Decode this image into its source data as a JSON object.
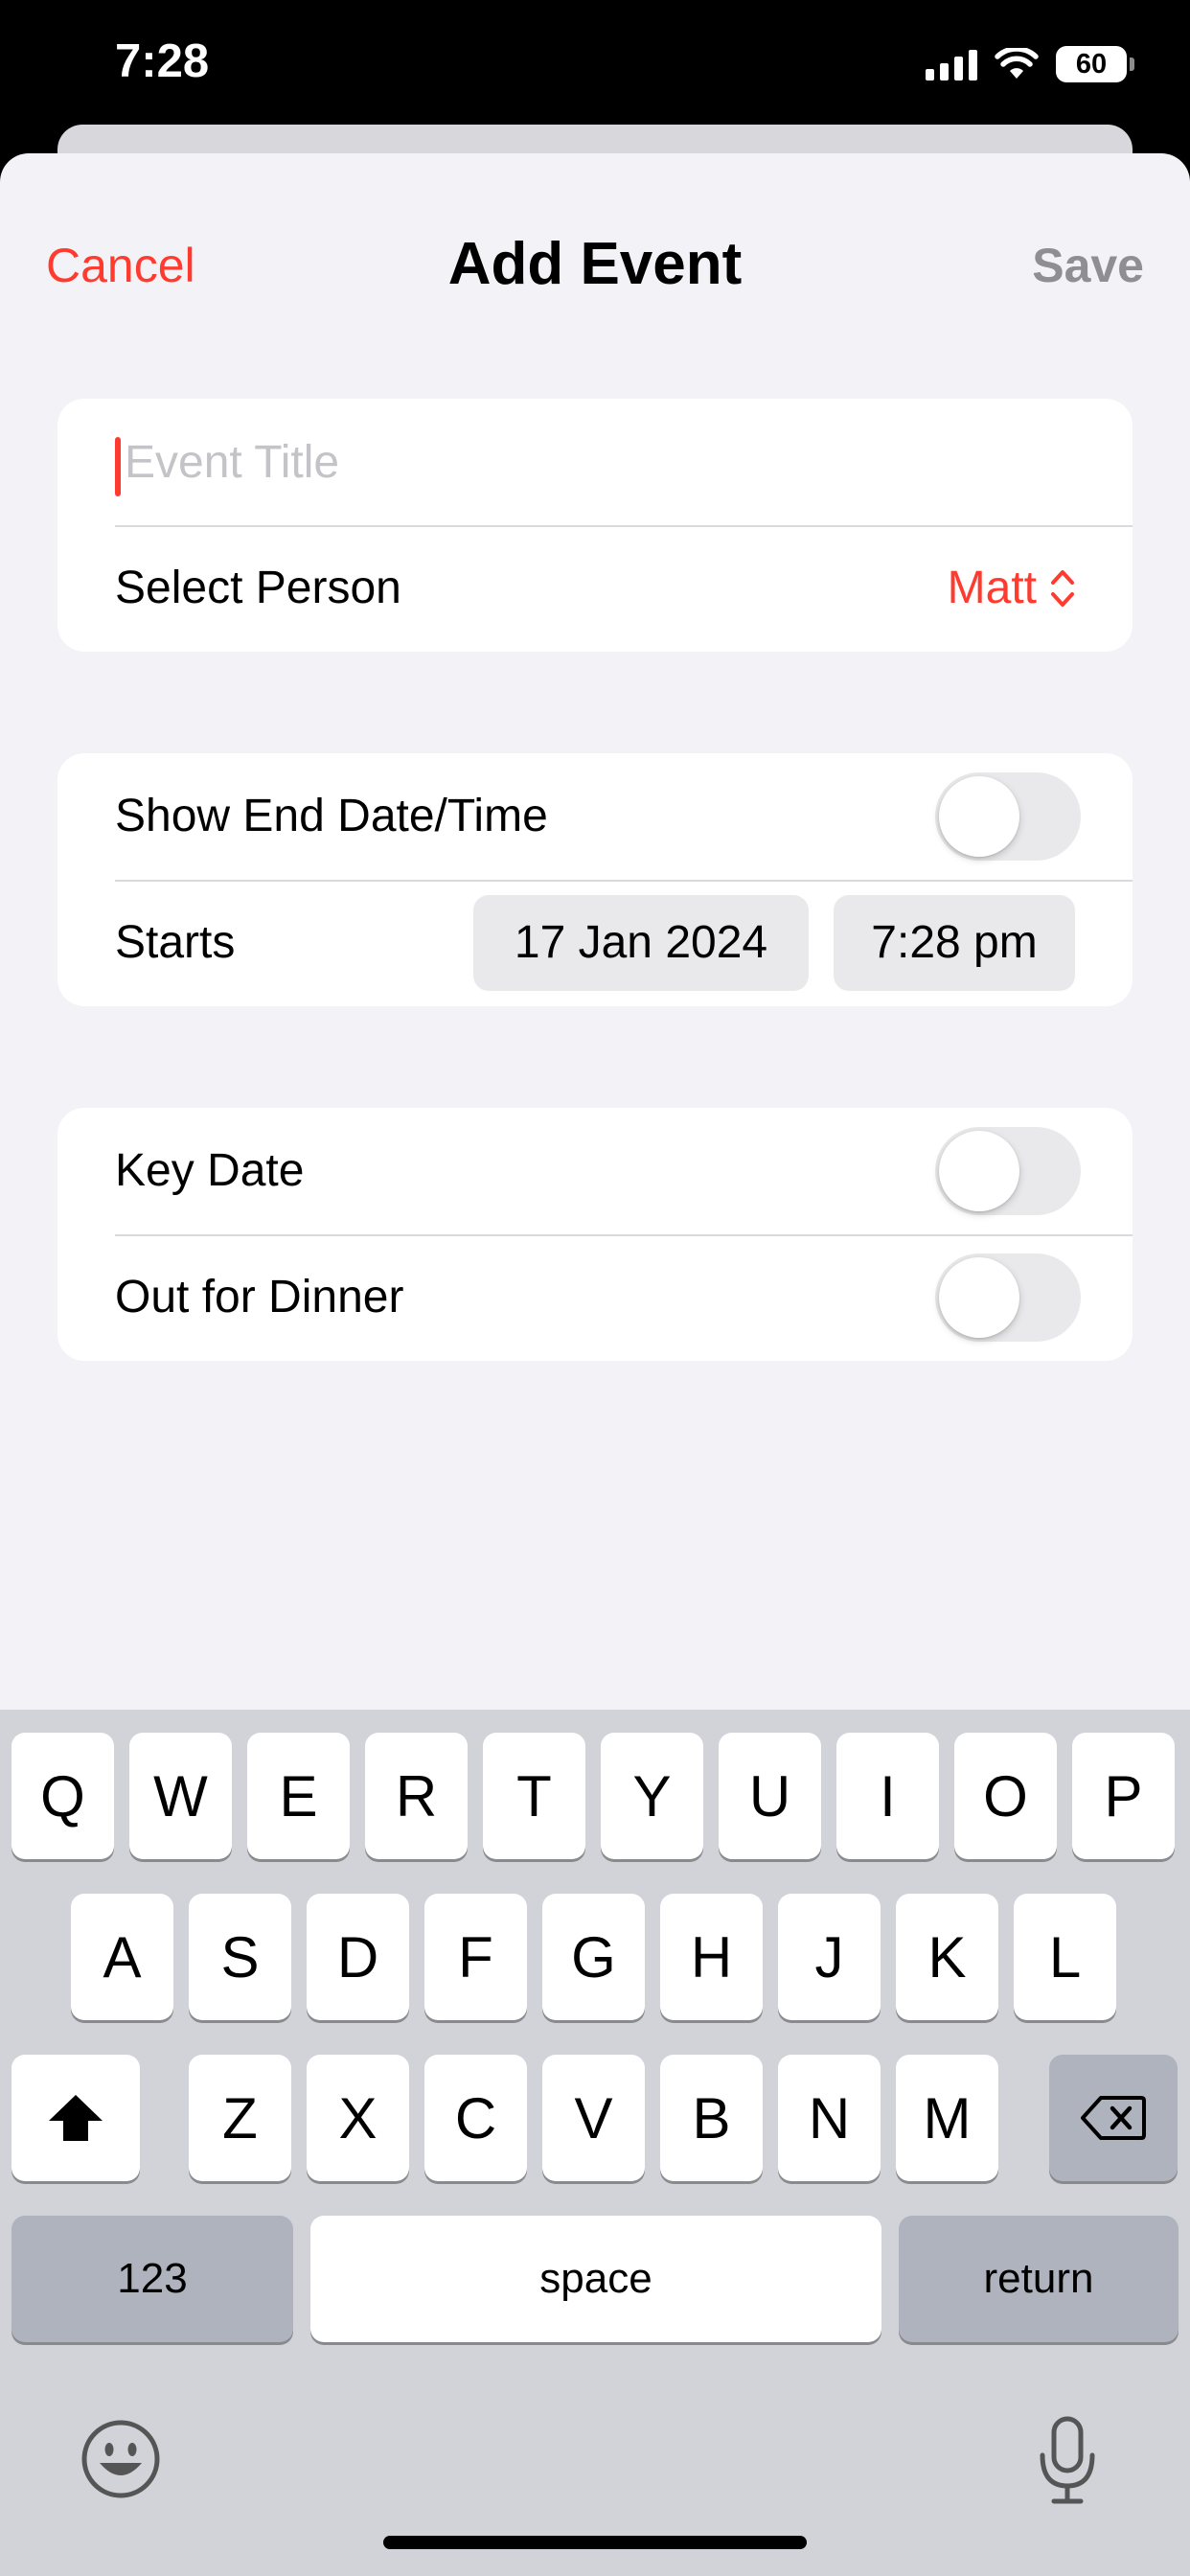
{
  "status_bar": {
    "time": "7:28",
    "battery": "60",
    "icons": [
      "cellular-signal-icon",
      "wifi-icon",
      "battery-icon"
    ]
  },
  "nav": {
    "cancel": "Cancel",
    "title": "Add Event",
    "save": "Save"
  },
  "form": {
    "title_placeholder": "Event Title",
    "title_value": "",
    "select_person_label": "Select Person",
    "select_person_value": "Matt",
    "show_end_label": "Show End Date/Time",
    "show_end_on": false,
    "starts_label": "Starts",
    "start_date": "17 Jan 2024",
    "start_time": "7:28 pm",
    "key_date_label": "Key Date",
    "key_date_on": false,
    "out_for_dinner_label": "Out for Dinner",
    "out_for_dinner_on": false
  },
  "keyboard": {
    "row1": [
      "Q",
      "W",
      "E",
      "R",
      "T",
      "Y",
      "U",
      "I",
      "O",
      "P"
    ],
    "row2": [
      "A",
      "S",
      "D",
      "F",
      "G",
      "H",
      "J",
      "K",
      "L"
    ],
    "row3": [
      "Z",
      "X",
      "C",
      "V",
      "B",
      "N",
      "M"
    ],
    "numbers": "123",
    "space": "space",
    "return": "return"
  },
  "colors": {
    "accent": "#ff3b30",
    "background": "#f2f2f7",
    "keyboard": "#d1d3d9",
    "disabled": "#8e8e93"
  }
}
